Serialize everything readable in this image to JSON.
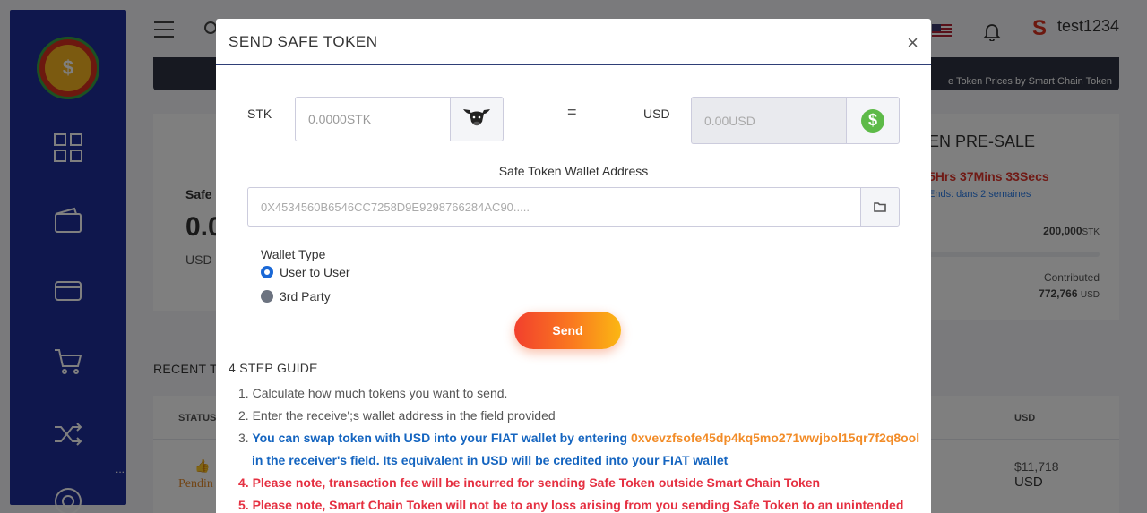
{
  "header": {
    "username": "test1234"
  },
  "ticker": {
    "text": "e Token Prices by Smart Chain Token"
  },
  "balance_card": {
    "label": "Safe",
    "amount": "0.0",
    "currency": "USD"
  },
  "presale_card": {
    "title": "EN PRE-SALE",
    "countdown": "5Hrs 37Mins 33Secs",
    "ends": "Ends: dans 2 semaines",
    "target_value": "200,000",
    "target_unit": "STK",
    "contributed_label": "Contributed",
    "contributed_value": "772,766",
    "contributed_unit": "USD"
  },
  "recent": {
    "title": "RECENT T",
    "columns": {
      "status": "STATUS",
      "usd": "USD"
    },
    "row": {
      "status": "Pendin",
      "usd_amount": "$11,718",
      "usd_currency": "USD"
    }
  },
  "modal": {
    "title": "SEND SAFE TOKEN",
    "close": "×",
    "stk_label": "STK",
    "stk_placeholder": "0.0000STK",
    "equals": "=",
    "usd_label": "USD",
    "usd_placeholder": "0.00USD",
    "wallet_label": "Safe Token Wallet Address",
    "wallet_placeholder": "0X4534560B6546CC7258D9E9298766284AC90.....",
    "wallet_type_label": "Wallet Type",
    "options": [
      {
        "label": "User to User",
        "checked": true
      },
      {
        "label": "3rd Party",
        "checked": false
      }
    ],
    "send": "Send",
    "guide_title": "4 STEP GUIDE",
    "steps": {
      "s1": "Calculate how much tokens you want to send.",
      "s2": "Enter the receive';s wallet address in the field provided",
      "s3a": "You can swap token with USD into your FIAT wallet by entering ",
      "s3_code": "0xvevzfsofe45dp4kq5mo271wwjbol15qr7f2q8ool",
      "s3b": "in the receiver's field. Its equivalent in USD will be credited into your FIAT wallet",
      "s4": "Please note, transaction fee will be incurred for sending Safe Token outside Smart Chain Token",
      "s5": "Please note, Smart Chain Token will not be to any loss arising from you sending Safe Token to an unintended"
    },
    "step_numbers": [
      "1.",
      "2.",
      "3.",
      "4.",
      "5."
    ]
  },
  "icons": {
    "sidebar": [
      "dashboard-icon",
      "wallet-icon",
      "card-icon",
      "cart-icon",
      "shuffle-icon",
      "support-icon"
    ],
    "colors": {
      "accent": "#1f2f9a",
      "send_start": "#f2402d",
      "send_end": "#fbb713",
      "warning": "#e53041",
      "info": "#1565c0"
    }
  }
}
